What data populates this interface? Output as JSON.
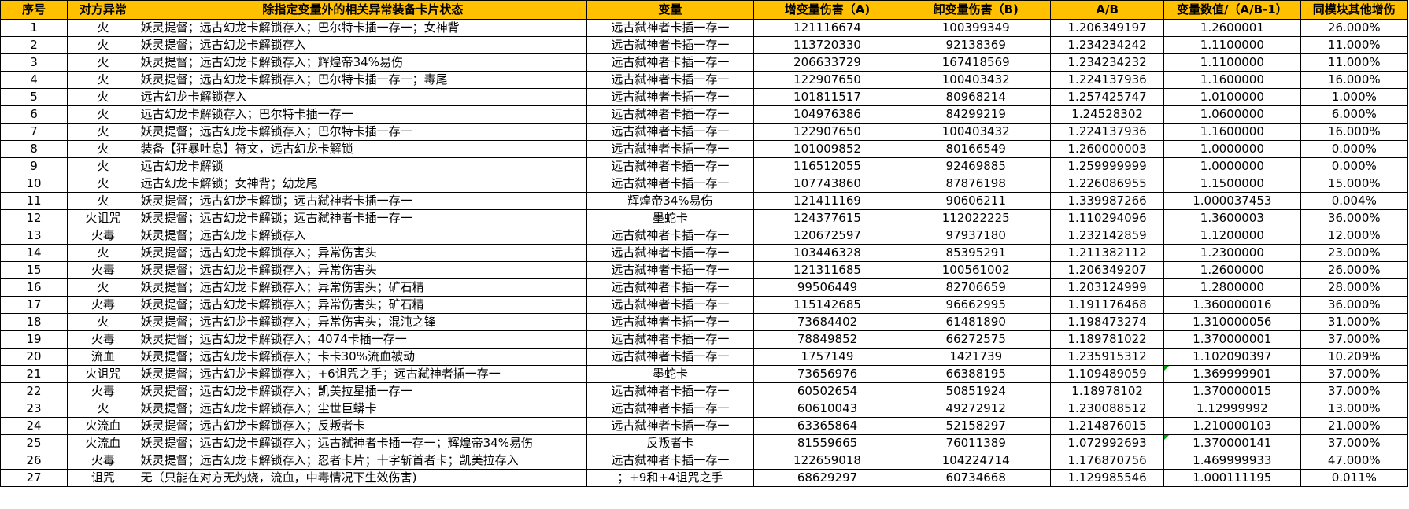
{
  "headers": [
    "序号",
    "对方异常",
    "除指定变量外的相关异常装备卡片状态",
    "变量",
    "增变量伤害（A)",
    "卸变量伤害（B)",
    "A/B",
    "变量数值/（A/B-1）",
    "同模块其他增伤"
  ],
  "rows": [
    {
      "id": "1",
      "anomaly": "火",
      "state": "妖灵提督；远古幻龙卡解锁存入；巴尔特卡插一存一；女神背",
      "variable": "远古弑神者卡插一存一",
      "a": "121116674",
      "b": "100399349",
      "ab": "1.206349197",
      "ratio": "1.2600001",
      "other": "26.000%"
    },
    {
      "id": "2",
      "anomaly": "火",
      "state": "妖灵提督；远古幻龙卡解锁存入",
      "variable": "远古弑神者卡插一存一",
      "a": "113720330",
      "b": "92138369",
      "ab": "1.234234242",
      "ratio": "1.1100000",
      "other": "11.000%"
    },
    {
      "id": "3",
      "anomaly": "火",
      "state": "妖灵提督；远古幻龙卡解锁存入；辉煌帝34%易伤",
      "variable": "远古弑神者卡插一存一",
      "a": "206633729",
      "b": "167418569",
      "ab": "1.234234232",
      "ratio": "1.1100000",
      "other": "11.000%"
    },
    {
      "id": "4",
      "anomaly": "火",
      "state": "妖灵提督；远古幻龙卡解锁存入；巴尔特卡插一存一；毒尾",
      "variable": "远古弑神者卡插一存一",
      "a": "122907650",
      "b": "100403432",
      "ab": "1.224137936",
      "ratio": "1.1600000",
      "other": "16.000%"
    },
    {
      "id": "5",
      "anomaly": "火",
      "state": "远古幻龙卡解锁存入",
      "variable": "远古弑神者卡插一存一",
      "a": "101811517",
      "b": "80968214",
      "ab": "1.257425747",
      "ratio": "1.0100000",
      "other": "1.000%"
    },
    {
      "id": "6",
      "anomaly": "火",
      "state": "远古幻龙卡解锁存入；巴尔特卡插一存一",
      "variable": "远古弑神者卡插一存一",
      "a": "104976386",
      "b": "84299219",
      "ab": "1.24528302",
      "ratio": "1.0600000",
      "other": "6.000%"
    },
    {
      "id": "7",
      "anomaly": "火",
      "state": "妖灵提督；远古幻龙卡解锁存入；巴尔特卡插一存一",
      "variable": "远古弑神者卡插一存一",
      "a": "122907650",
      "b": "100403432",
      "ab": "1.224137936",
      "ratio": "1.1600000",
      "other": "16.000%"
    },
    {
      "id": "8",
      "anomaly": "火",
      "state": "装备【狂暴吐息】符文，远古幻龙卡解锁",
      "variable": "远古弑神者卡插一存一",
      "a": "101009852",
      "b": "80166549",
      "ab": "1.260000003",
      "ratio": "1.0000000",
      "other": "0.000%"
    },
    {
      "id": "9",
      "anomaly": "火",
      "state": "远古幻龙卡解锁",
      "variable": "远古弑神者卡插一存一",
      "a": "116512055",
      "b": "92469885",
      "ab": "1.259999999",
      "ratio": "1.0000000",
      "other": "0.000%"
    },
    {
      "id": "10",
      "anomaly": "火",
      "state": "远古幻龙卡解锁；女神背；幼龙尾",
      "variable": "远古弑神者卡插一存一",
      "a": "107743860",
      "b": "87876198",
      "ab": "1.226086955",
      "ratio": "1.1500000",
      "other": "15.000%"
    },
    {
      "id": "11",
      "anomaly": "火",
      "state": "妖灵提督；远古幻龙卡解锁；远古弑神者卡插一存一",
      "variable": "辉煌帝34%易伤",
      "a": "121411169",
      "b": "90606211",
      "ab": "1.339987266",
      "ratio": "1.000037453",
      "other": "0.004%"
    },
    {
      "id": "12",
      "anomaly": "火诅咒",
      "state": "妖灵提督；远古幻龙卡解锁；远古弑神者卡插一存一",
      "variable": "墨蛇卡",
      "a": "124377615",
      "b": "112022225",
      "ab": "1.110294096",
      "ratio": "1.3600003",
      "other": "36.000%"
    },
    {
      "id": "13",
      "anomaly": "火毒",
      "state": "妖灵提督；远古幻龙卡解锁存入",
      "variable": "远古弑神者卡插一存一",
      "a": "120672597",
      "b": "97937180",
      "ab": "1.232142859",
      "ratio": "1.1200000",
      "other": "12.000%"
    },
    {
      "id": "14",
      "anomaly": "火",
      "state": "妖灵提督；远古幻龙卡解锁存入；异常伤害头",
      "variable": "远古弑神者卡插一存一",
      "a": "103446328",
      "b": "85395291",
      "ab": "1.211382112",
      "ratio": "1.2300000",
      "other": "23.000%"
    },
    {
      "id": "15",
      "anomaly": "火毒",
      "state": "妖灵提督；远古幻龙卡解锁存入；异常伤害头",
      "variable": "远古弑神者卡插一存一",
      "a": "121311685",
      "b": "100561002",
      "ab": "1.206349207",
      "ratio": "1.2600000",
      "other": "26.000%"
    },
    {
      "id": "16",
      "anomaly": "火",
      "state": "妖灵提督；远古幻龙卡解锁存入；异常伤害头；矿石精",
      "variable": "远古弑神者卡插一存一",
      "a": "99506449",
      "b": "82706659",
      "ab": "1.203124999",
      "ratio": "1.2800000",
      "other": "28.000%"
    },
    {
      "id": "17",
      "anomaly": "火毒",
      "state": "妖灵提督；远古幻龙卡解锁存入；异常伤害头；矿石精",
      "variable": "远古弑神者卡插一存一",
      "a": "115142685",
      "b": "96662995",
      "ab": "1.191176468",
      "ratio": "1.360000016",
      "other": "36.000%"
    },
    {
      "id": "18",
      "anomaly": "火",
      "state": "妖灵提督；远古幻龙卡解锁存入；异常伤害头；混沌之锋",
      "variable": "远古弑神者卡插一存一",
      "a": "73684402",
      "b": "61481890",
      "ab": "1.198473274",
      "ratio": "1.310000056",
      "other": "31.000%"
    },
    {
      "id": "19",
      "anomaly": "火毒",
      "state": "妖灵提督；远古幻龙卡解锁存入；4074卡插一存一",
      "variable": "远古弑神者卡插一存一",
      "a": "78849852",
      "b": "66272575",
      "ab": "1.189781022",
      "ratio": "1.370000001",
      "other": "37.000%"
    },
    {
      "id": "20",
      "anomaly": "流血",
      "state": "妖灵提督；远古幻龙卡解锁存入；卡卡30%流血被动",
      "variable": "远古弑神者卡插一存一",
      "a": "1757149",
      "b": "1421739",
      "ab": "1.235915312",
      "ratio": "1.102090397",
      "other": "10.209%"
    },
    {
      "id": "21",
      "anomaly": "火诅咒",
      "state": "妖灵提督；远古幻龙卡解锁存入；+6诅咒之手；远古弑神者插一存一",
      "variable": "墨蛇卡",
      "a": "73656976",
      "b": "66388195",
      "ab": "1.109489059",
      "ratio": "1.369999901",
      "other": "37.000%",
      "flag": true
    },
    {
      "id": "22",
      "anomaly": "火毒",
      "state": "妖灵提督；远古幻龙卡解锁存入；凯美拉星插一存一",
      "variable": "远古弑神者卡插一存一",
      "a": "60502654",
      "b": "50851924",
      "ab": "1.18978102",
      "ratio": "1.370000015",
      "other": "37.000%"
    },
    {
      "id": "23",
      "anomaly": "火",
      "state": "妖灵提督；远古幻龙卡解锁存入；尘世巨蟒卡",
      "variable": "远古弑神者卡插一存一",
      "a": "60610043",
      "b": "49272912",
      "ab": "1.230088512",
      "ratio": "1.12999992",
      "other": "13.000%"
    },
    {
      "id": "24",
      "anomaly": "火流血",
      "state": "妖灵提督；远古幻龙卡解锁存入；反叛者卡",
      "variable": "远古弑神者卡插一存一",
      "a": "63365864",
      "b": "52158297",
      "ab": "1.214876015",
      "ratio": "1.210000103",
      "other": "21.000%"
    },
    {
      "id": "25",
      "anomaly": "火流血",
      "state": "妖灵提督；远古幻龙卡解锁存入；远古弑神者卡插一存一；辉煌帝34%易伤",
      "variable": "反叛者卡",
      "a": "81559665",
      "b": "76011389",
      "ab": "1.072992693",
      "ratio": "1.370000141",
      "other": "37.000%",
      "flag": true
    },
    {
      "id": "26",
      "anomaly": "火毒",
      "state": "妖灵提督；远古幻龙卡解锁存入；忍者卡片；十字斩首者卡；凯美拉存入",
      "variable": "远古弑神者卡插一存一",
      "a": "122659018",
      "b": "104224714",
      "ab": "1.176870756",
      "ratio": "1.469999933",
      "other": "47.000%"
    },
    {
      "id": "27",
      "anomaly": "诅咒",
      "state": "无（只能在对方无灼烧，流血，中毒情况下生效伤害)",
      "variable": "；+9和+4诅咒之手",
      "a": "68629297",
      "b": "60734668",
      "ab": "1.129985546",
      "ratio": "1.000111195",
      "other": "0.011%",
      "red": true
    }
  ]
}
